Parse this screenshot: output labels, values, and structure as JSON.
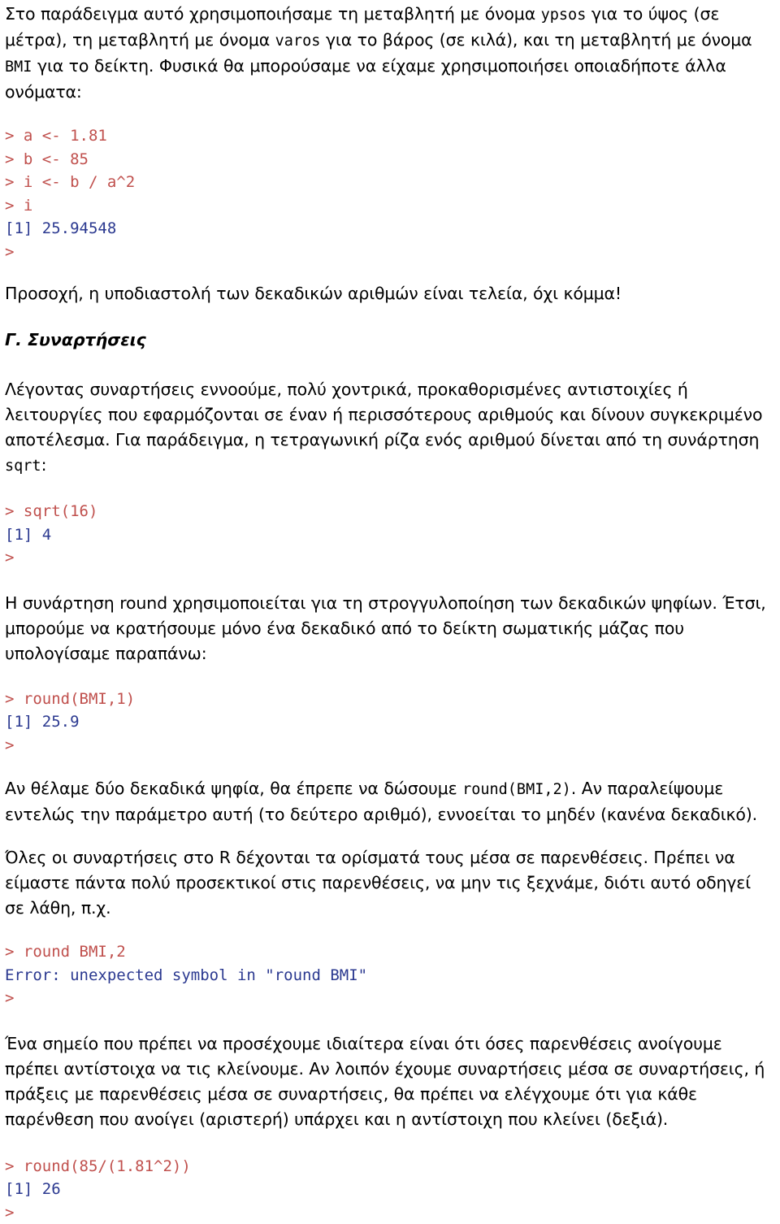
{
  "document": {
    "language": "el",
    "colors": {
      "background": "#ffffff",
      "body_text": "#000000",
      "console_input": "#c0504d",
      "console_output": "#2b3990"
    }
  },
  "intro_paragraph": {
    "part1": "Στο παράδειγμα αυτό χρησιμοποιήσαμε τη μεταβλητή με όνομα ",
    "code1": "ypsos",
    "part2": " για το ύψος (σε μέτρα), τη μεταβλητή με όνομα ",
    "code2": "varos",
    "part3": " για το βάρος (σε κιλά), και τη μεταβλητή με όνομα ",
    "code3": "BMI",
    "part4": " για το δείκτη.  Φυσικά θα μπορούσαμε να είχαμε χρησιμοποιήσει οποιαδήποτε άλλα ονόματα:"
  },
  "console_bmi": {
    "lines": [
      {
        "type": "in",
        "text": "> a <- 1.81"
      },
      {
        "type": "in",
        "text": "> b <- 85"
      },
      {
        "type": "in",
        "text": "> i <- b / a^2"
      },
      {
        "type": "in",
        "text": "> i"
      },
      {
        "type": "out",
        "text": "[1] 25.94548"
      },
      {
        "type": "in",
        "text": ">"
      }
    ]
  },
  "note_decimal": "Προσοχή, η υποδιαστολή των δεκαδικών αριθμών είναι τελεία, όχι κόμμα!",
  "heading_functions": "Γ. Συναρτήσεις",
  "functions_paragraph": {
    "part1": "Λέγοντας συναρτήσεις εννοούμε, πολύ χοντρικά, προκαθορισμένες αντιστοιχίες ή λειτουργίες που εφαρμόζονται σε έναν ή περισσότερους αριθμούς και δίνουν συγκεκριμένο αποτέλεσμα. Για παράδειγμα, η τετραγωνική ρίζα ενός αριθμού δίνεται από τη συνάρτηση ",
    "code1": "sqrt",
    "part2": ":"
  },
  "console_sqrt": {
    "lines": [
      {
        "type": "in",
        "text": "> sqrt(16)"
      },
      {
        "type": "out",
        "text": "[1] 4"
      },
      {
        "type": "in",
        "text": ">"
      }
    ]
  },
  "round_paragraph": "Η συνάρτηση round χρησιμοποιείται για τη στρογγυλοποίηση των δεκαδικών ψηφίων. Έτσι, μπορούμε να κρατήσουμε μόνο ένα δεκαδικό από το δείκτη σωματικής μάζας που υπολογίσαμε παραπάνω:",
  "console_round1": {
    "lines": [
      {
        "type": "in",
        "text": "> round(BMI,1)"
      },
      {
        "type": "out",
        "text": "[1] 25.9"
      },
      {
        "type": "in",
        "text": ">"
      }
    ]
  },
  "round2_paragraph": {
    "part1": "Αν θέλαμε δύο δεκαδικά ψηφία, θα έπρεπε να δώσουμε ",
    "code1": "round(BMI,2)",
    "part2": ". Αν παραλείψουμε εντελώς την παράμετρο αυτή (το δεύτερο αριθμό), εννοείται το μηδέν (κανένα δεκαδικό)."
  },
  "parentheses_paragraph": "Όλες οι συναρτήσεις στο R δέχονται τα ορίσματά τους μέσα σε παρενθέσεις. Πρέπει να είμαστε πάντα πολύ προσεκτικοί στις παρενθέσεις, να μην τις ξεχνάμε, διότι αυτό οδηγεί σε λάθη, π.χ.",
  "console_error": {
    "lines": [
      {
        "type": "in",
        "text": "> round BMI,2"
      },
      {
        "type": "out",
        "text": "Error: unexpected symbol in \"round BMI\""
      },
      {
        "type": "in",
        "text": ">"
      }
    ]
  },
  "matching_paragraph": "Ένα σημείο που πρέπει να προσέχουμε ιδιαίτερα είναι ότι όσες παρενθέσεις ανοίγουμε πρέπει αντίστοιχα να τις κλείνουμε. Αν λοιπόν έχουμε συναρτήσεις μέσα σε συναρτήσεις, ή πράξεις με παρενθέσεις μέσα σε συναρτήσεις, θα πρέπει να ελέγχουμε ότι για κάθε παρένθεση που ανοίγει (αριστερή) υπάρχει και η αντίστοιχη που κλείνει (δεξιά).",
  "console_nested": {
    "lines": [
      {
        "type": "in",
        "text": "> round(85/(1.81^2))"
      },
      {
        "type": "out",
        "text": "[1] 26"
      },
      {
        "type": "in",
        "text": ">"
      }
    ]
  }
}
